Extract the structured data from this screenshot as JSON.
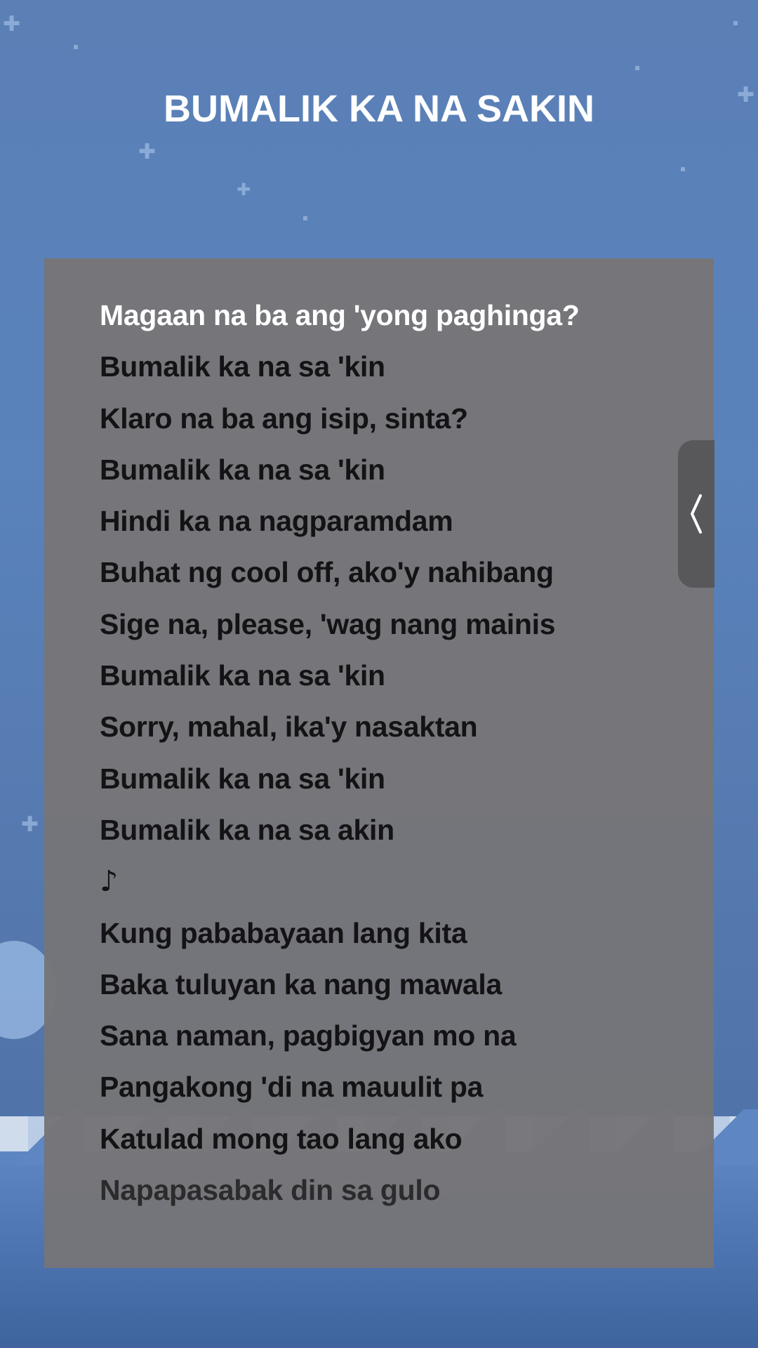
{
  "song_title": "BUMALIK KA NA SAKIN",
  "lyrics": [
    {
      "text": "Magaan na ba ang 'yong paghinga?",
      "state": "active"
    },
    {
      "text": "Bumalik ka na sa 'kin",
      "state": "normal"
    },
    {
      "text": "Klaro na ba ang isip, sinta?",
      "state": "normal"
    },
    {
      "text": "Bumalik ka na sa 'kin",
      "state": "normal"
    },
    {
      "text": "Hindi ka na nagparamdam",
      "state": "normal"
    },
    {
      "text": "Buhat ng cool off, ako'y nahibang",
      "state": "normal"
    },
    {
      "text": "Sige na, please, 'wag nang mainis",
      "state": "normal"
    },
    {
      "text": "Bumalik ka na sa 'kin",
      "state": "normal"
    },
    {
      "text": "Sorry, mahal, ika'y nasaktan",
      "state": "normal"
    },
    {
      "text": "Bumalik ka na sa 'kin",
      "state": "normal"
    },
    {
      "text": "Bumalik ka na sa akin",
      "state": "normal"
    },
    {
      "text": "♪",
      "state": "note"
    },
    {
      "text": "Kung pababayaan lang kita",
      "state": "normal"
    },
    {
      "text": "Baka tuluyan ka nang mawala",
      "state": "normal"
    },
    {
      "text": "Sana naman, pagbigyan mo na",
      "state": "normal"
    },
    {
      "text": "Pangakong 'di na mauulit pa",
      "state": "normal"
    },
    {
      "text": "Katulad mong tao lang ako",
      "state": "normal"
    },
    {
      "text": "Napapasabak din sa gulo",
      "state": "fade"
    }
  ],
  "side_handle": {
    "icon": "chevron-left-icon"
  },
  "colors": {
    "background": "#5a80b6",
    "panel": "#767578",
    "active_lyric": "#ffffff",
    "lyric": "#131315"
  }
}
